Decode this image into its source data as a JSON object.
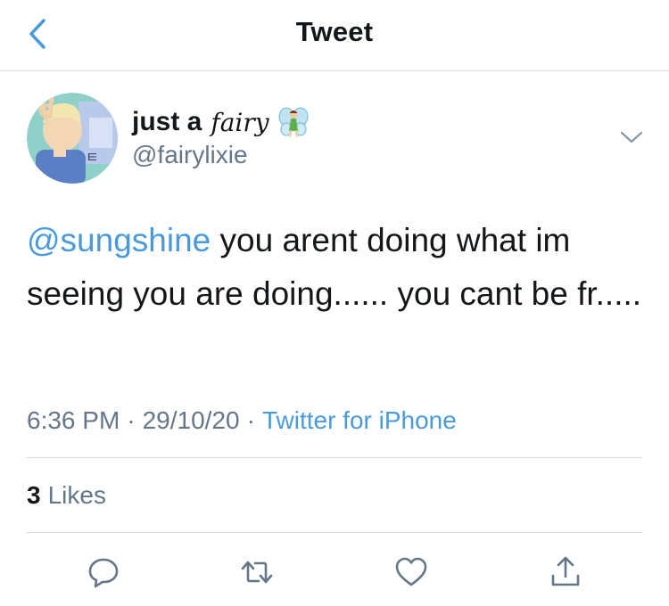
{
  "header": {
    "title": "Tweet"
  },
  "author": {
    "name_main": "just a",
    "name_fancy": "fairy",
    "name_emoji_icon": "fairy-icon",
    "handle": "@fairylixie"
  },
  "tweet": {
    "mention": "@sungshine",
    "text": " you arent doing what im seeing you are doing...... you cant be fr....."
  },
  "meta": {
    "time": "6:36 PM",
    "separator": "·",
    "date": "29/10/20",
    "source": "Twitter for iPhone"
  },
  "engagement": {
    "likes_count": "3",
    "likes_label": "Likes"
  },
  "actions": [
    "reply-icon",
    "retweet-icon",
    "like-icon",
    "share-icon"
  ],
  "colors": {
    "accent": "#4a9adb",
    "secondary_text": "#657786",
    "divider": "#d6d9dc"
  }
}
